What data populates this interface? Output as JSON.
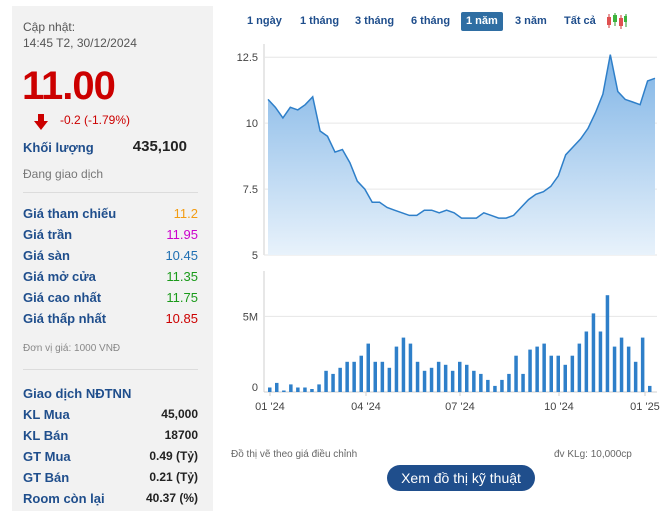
{
  "summary": {
    "update_label": "Cập nhật:",
    "update_time": "14:45 T2, 30/12/2024",
    "price": "11.00",
    "change": "-0.2 (-1.79%)",
    "volume_label": "Khối lượng",
    "volume_value": "435,100",
    "status": "Đang giao dịch"
  },
  "prices": [
    {
      "label": "Giá tham chiếu",
      "value": "11.2",
      "color": "#f39c12"
    },
    {
      "label": "Giá trần",
      "value": "11.95",
      "color": "#cc00cc"
    },
    {
      "label": "Giá sàn",
      "value": "10.45",
      "color": "#1f6fb2"
    },
    {
      "label": "Giá mở cửa",
      "value": "11.35",
      "color": "#1a9a1a"
    },
    {
      "label": "Giá cao nhất",
      "value": "11.75",
      "color": "#1a9a1a"
    },
    {
      "label": "Giá thấp nhất",
      "value": "10.85",
      "color": "#cc0000"
    }
  ],
  "unit_note": "Đơn vị giá: 1000 VNĐ",
  "foreign": {
    "title": "Giao dịch NĐTNN",
    "rows": [
      {
        "label": "KL Mua",
        "value": "45,000"
      },
      {
        "label": "KL Bán",
        "value": "18700"
      },
      {
        "label": "GT Mua",
        "value": "0.49 (Tỷ)"
      },
      {
        "label": "GT Bán",
        "value": "0.21 (Tỷ)"
      },
      {
        "label": "Room còn lại",
        "value": "40.37 (%)"
      }
    ]
  },
  "tabs": [
    {
      "label": "1 ngày",
      "active": false
    },
    {
      "label": "1 tháng",
      "active": false
    },
    {
      "label": "3 tháng",
      "active": false
    },
    {
      "label": "6 tháng",
      "active": false
    },
    {
      "label": "1 năm",
      "active": true
    },
    {
      "label": "3 năm",
      "active": false
    },
    {
      "label": "Tất cả",
      "active": false
    }
  ],
  "icons": {
    "candles": "candlestick-icon",
    "down": "arrow-down-icon"
  },
  "colors": {
    "accent": "#1f4e8c",
    "down": "#cc0000",
    "area": "#9cc7ec",
    "line": "#2e7fc9",
    "bar": "#2e7fc9"
  },
  "chart_data": [
    {
      "type": "area",
      "y_ticks": [
        "12.5",
        "10",
        "7.5",
        "5"
      ],
      "ylim": [
        5,
        13
      ],
      "values": [
        10.9,
        10.6,
        10.2,
        10.6,
        10.5,
        10.7,
        11.0,
        9.7,
        9.5,
        8.9,
        9.0,
        8.5,
        7.8,
        7.5,
        7.0,
        7.0,
        6.8,
        6.7,
        6.6,
        6.5,
        6.5,
        6.7,
        6.7,
        6.6,
        6.7,
        6.6,
        6.4,
        6.4,
        6.4,
        6.6,
        6.5,
        6.4,
        6.4,
        6.5,
        6.8,
        7.1,
        7.3,
        7.4,
        7.6,
        8.0,
        8.8,
        9.1,
        9.4,
        9.8,
        10.4,
        11.1,
        12.6,
        11.2,
        10.9,
        10.8,
        10.7,
        11.6,
        11.7
      ],
      "grid": true
    },
    {
      "type": "bar",
      "y_ticks": [
        "5M",
        "0"
      ],
      "ylim": [
        0,
        8
      ],
      "x_ticks": [
        "01 '24",
        "04 '24",
        "07 '24",
        "10 '24",
        "01 '25"
      ],
      "values": [
        0.3,
        0.6,
        0.1,
        0.5,
        0.3,
        0.3,
        0.2,
        0.5,
        1.4,
        1.2,
        1.6,
        2.0,
        2.0,
        2.4,
        3.2,
        2.0,
        2.0,
        1.6,
        3.0,
        3.6,
        3.2,
        2.0,
        1.4,
        1.6,
        2.0,
        1.8,
        1.4,
        2.0,
        1.8,
        1.4,
        1.2,
        0.8,
        0.4,
        0.8,
        1.2,
        2.4,
        1.2,
        2.8,
        3.0,
        3.2,
        2.4,
        2.4,
        1.8,
        2.4,
        3.2,
        4.0,
        5.2,
        4.0,
        6.4,
        3.0,
        3.6,
        3.0,
        2.0,
        3.6,
        0.4
      ],
      "grid": true
    }
  ],
  "footer": {
    "adjusted_note": "Đồ thị vẽ theo giá điều chỉnh",
    "volume_unit": "đv KLg: 10,000cp",
    "tech_button": "Xem đồ thị kỹ thuật"
  }
}
